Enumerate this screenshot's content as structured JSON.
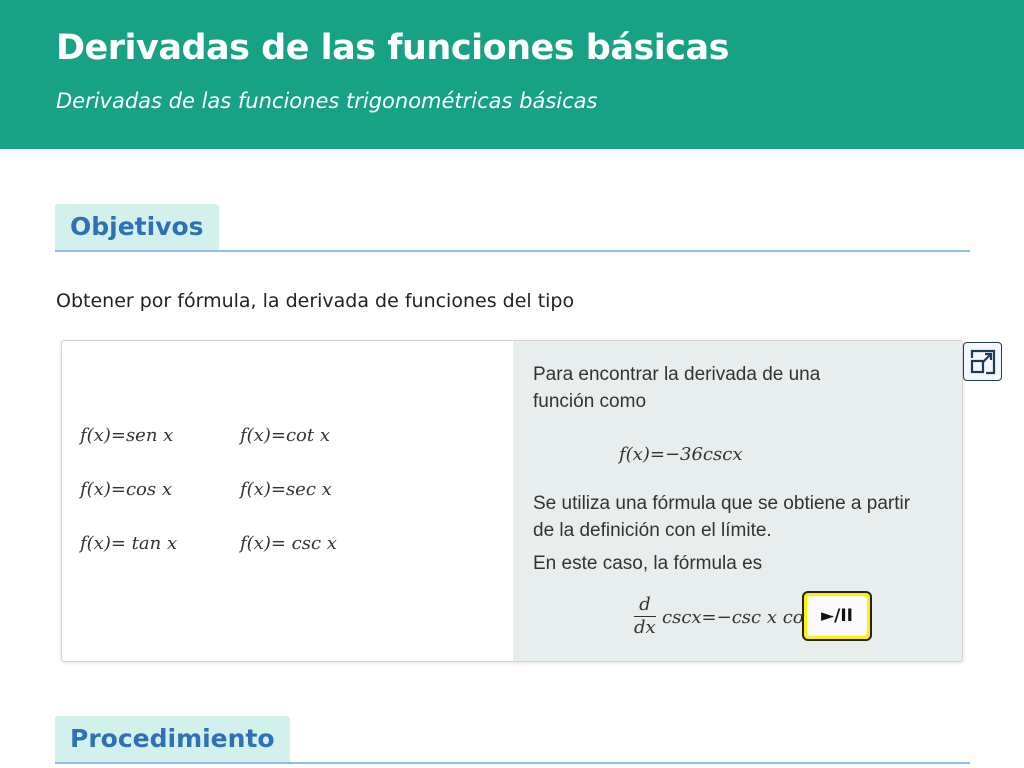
{
  "header": {
    "title": "Derivadas de las funciones básicas",
    "subtitle": "Derivadas de las funciones trigonométricas básicas"
  },
  "sections": {
    "objetivos": "Objetivos",
    "procedimiento": "Procedimiento"
  },
  "intro": "Obtener por fórmula, la derivada de funciones del tipo",
  "scene": {
    "functions": [
      "f(x)=sen x",
      "f(x)=cot x",
      "f(x)=cos x",
      "f(x)=sec x",
      "f(x)= tan x",
      "f(x)= csc x"
    ],
    "text1": "Para encontrar la derivada de una función como",
    "example": "f(x)=−36cscx",
    "text2": "Se utiliza una fórmula que se obtiene  a partir de la definición con el límite.",
    "text3": "En este caso, la fórmula es",
    "formula_num": "d",
    "formula_den": "dx",
    "formula_rest": "cscx=−csc x cot x",
    "play_label": "►/II"
  },
  "icons": {
    "expand": "expand-icon"
  },
  "colors": {
    "header_bg": "#17a286",
    "tab_bg": "#d3f1ec",
    "tab_text": "#2e72b5",
    "rule": "#8fbdf0",
    "panel_bg": "#e7eeed",
    "play_bg": "#fff200"
  }
}
